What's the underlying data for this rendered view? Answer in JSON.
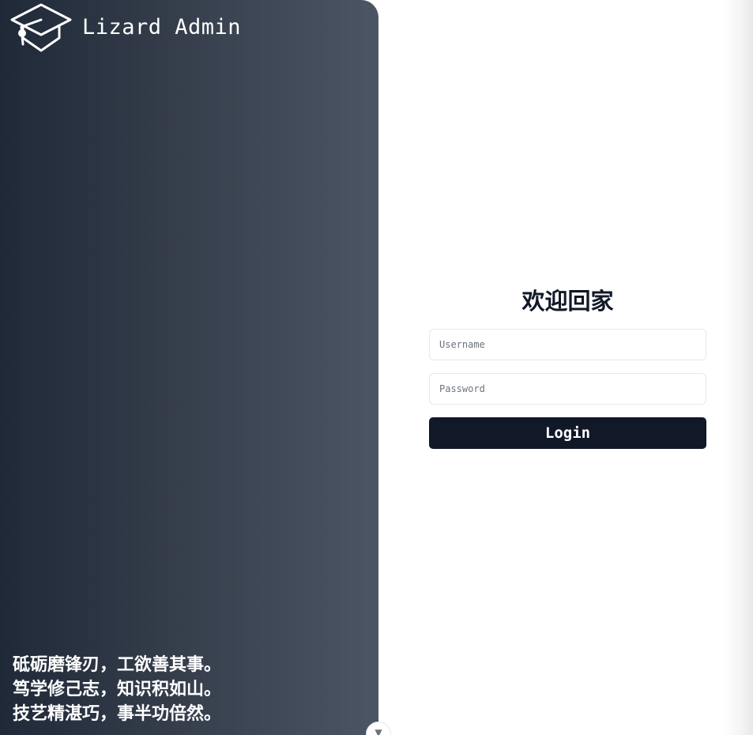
{
  "brand": {
    "name": "Lizard Admin",
    "logo_icon": "graduation-cap-icon"
  },
  "quote": {
    "lines": [
      "砥砺磨锋刃，工欲善其事。",
      "笃学修己志，知识积如山。",
      "技艺精湛巧，事半功倍然。"
    ]
  },
  "login": {
    "title": "欢迎回家",
    "username_placeholder": "Username",
    "username_value": "",
    "password_placeholder": "Password",
    "password_value": "",
    "button_label": "Login"
  },
  "toggle": {
    "icon": "collapse-toggle-icon"
  },
  "colors": {
    "panel_gradient_start": "#1f2937",
    "panel_gradient_end": "#4b5563",
    "button_bg": "#111827",
    "title_text": "#111827"
  }
}
